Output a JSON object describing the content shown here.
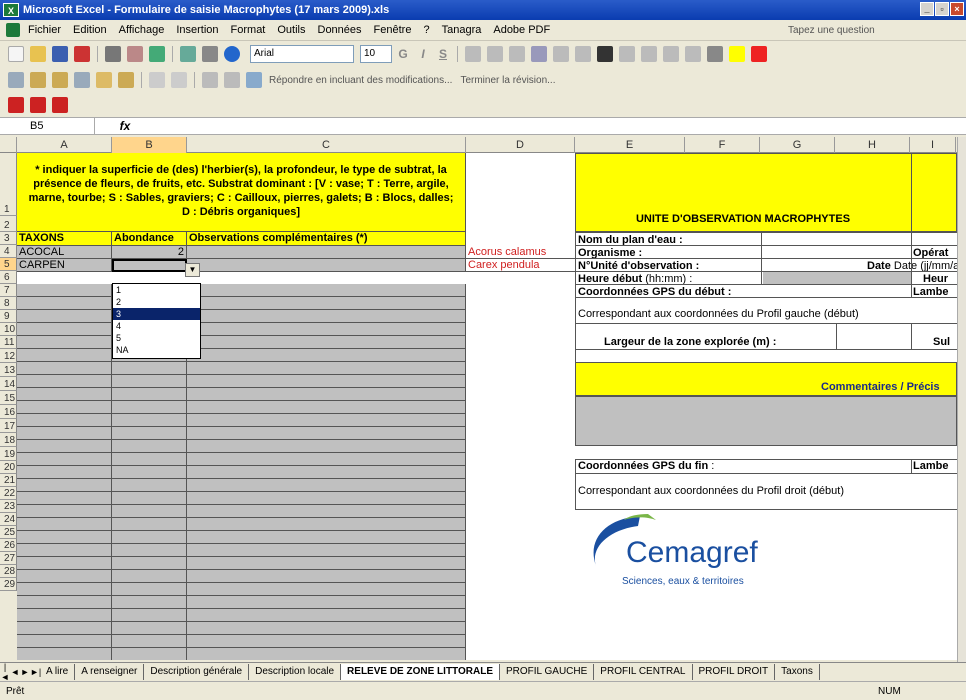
{
  "window": {
    "title": "Microsoft Excel - Formulaire de saisie Macrophytes (17 mars 2009).xls"
  },
  "menu": {
    "items": [
      "Fichier",
      "Edition",
      "Affichage",
      "Insertion",
      "Format",
      "Outils",
      "Données",
      "Fenêtre",
      "?",
      "Tanagra",
      "Adobe PDF"
    ],
    "ask": "Tapez une question"
  },
  "toolbar": {
    "font": "Arial",
    "size": "10",
    "reply": "Répondre en incluant des modifications...",
    "end_review": "Terminer la révision..."
  },
  "formula": {
    "namebox": "B5",
    "fx": "fx"
  },
  "columns": [
    "A",
    "B",
    "C",
    "D",
    "E",
    "F",
    "G",
    "H",
    "I"
  ],
  "rows": [
    "1",
    "2",
    "3",
    "4",
    "5",
    "6",
    "7",
    "8",
    "9",
    "10",
    "11",
    "12",
    "13",
    "14",
    "15",
    "16",
    "17",
    "18",
    "19",
    "20",
    "21",
    "22",
    "23",
    "24",
    "25",
    "26",
    "27",
    "28",
    "29"
  ],
  "header_note": "* indiquer la superficie de (des) l'herbier(s), la profondeur, le type de subtrat, la présence de fleurs, de fruits, etc. Substrat dominant : [V : vase; T : Terre, argile, marne, tourbe; S : Sables, graviers; C : Cailloux, pierres, galets; B : Blocs, dalles; D : Débris organiques]",
  "table_headers": {
    "taxons": "TAXONS",
    "abondance": "Abondance",
    "observations": "Observations complémentaires (*)"
  },
  "rows_data": [
    {
      "taxon": "ACOCAL",
      "abondance": "2",
      "name": "Acorus calamus"
    },
    {
      "taxon": "CARPEN",
      "abondance": "",
      "name": "Carex pendula"
    }
  ],
  "dropdown": {
    "options": [
      "1",
      "2",
      "3",
      "4",
      "5",
      "NA"
    ],
    "selected": "3"
  },
  "right": {
    "title": "UNITE D'OBSERVATION MACROPHYTES",
    "plan": "Nom du plan d'eau :",
    "organisme": "Organisme :",
    "operateur": "Opérat",
    "unite": "N°Unité d'observation :",
    "date": "Date (jj/mm/aaaa",
    "heure_debut": "Heure début",
    "heure_fmt": "(hh:mm) :",
    "heure": "Heur",
    "gps_debut": "Coordonnées GPS du début :",
    "lambert": "Lambe",
    "corr_debut": "Correspondant aux coordonnées du Profil gauche (début)",
    "largeur": "Largeur de la zone explorée (m) :",
    "sul": "Sul",
    "commentaires": "Commentaires / Précis",
    "gps_fin": "Coordonnées GPS du fin :",
    "lambert2": "Lambe",
    "corr_fin": "Correspondant aux coordonnées du Profil droit (début)"
  },
  "logo": {
    "name": "Cemagref",
    "tagline": "Sciences, eaux & territoires"
  },
  "tabs": [
    "A lire",
    "A renseigner",
    "Description générale",
    "Description locale",
    "RELEVE DE ZONE LITTORALE",
    "PROFIL GAUCHE",
    "PROFIL CENTRAL",
    "PROFIL DROIT",
    "Taxons"
  ],
  "status": {
    "left": "Prêt",
    "num": "NUM"
  }
}
